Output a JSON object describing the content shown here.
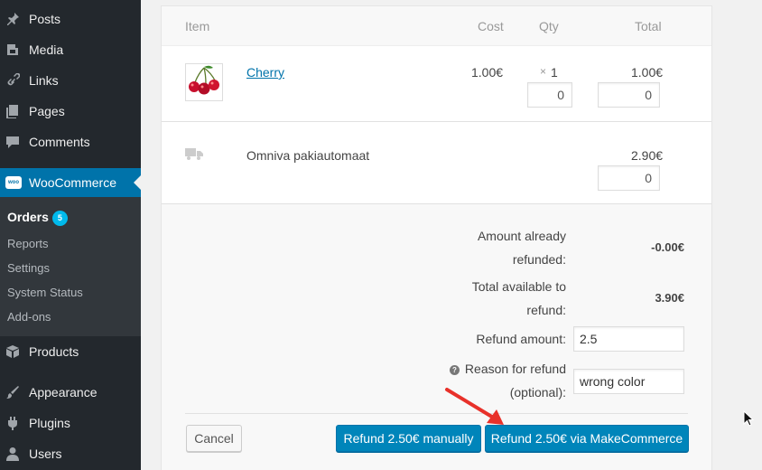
{
  "sidebar": {
    "items": [
      {
        "label": "Posts",
        "icon": "pin-icon"
      },
      {
        "label": "Media",
        "icon": "media-icon"
      },
      {
        "label": "Links",
        "icon": "link-icon"
      },
      {
        "label": "Pages",
        "icon": "pages-icon"
      },
      {
        "label": "Comments",
        "icon": "comment-icon"
      },
      {
        "label": "WooCommerce",
        "icon": "woo-icon"
      },
      {
        "label": "Products",
        "icon": "products-icon"
      },
      {
        "label": "Appearance",
        "icon": "brush-icon"
      },
      {
        "label": "Plugins",
        "icon": "plugin-icon"
      },
      {
        "label": "Users",
        "icon": "user-icon"
      }
    ],
    "woo_logo_text": "woo",
    "submenu": [
      {
        "label": "Orders",
        "count": "5"
      },
      {
        "label": "Reports"
      },
      {
        "label": "Settings"
      },
      {
        "label": "System Status"
      },
      {
        "label": "Add-ons"
      }
    ]
  },
  "table": {
    "headers": {
      "item": "Item",
      "cost": "Cost",
      "qty": "Qty",
      "total": "Total"
    },
    "line_item": {
      "name": "Cherry",
      "cost": "1.00€",
      "qty_prefix": "×",
      "qty": "1",
      "total": "1.00€",
      "refund_qty": "0",
      "refund_total": "0"
    },
    "shipping": {
      "name": "Omniva pakiautomaat",
      "total": "2.90€",
      "refund_total": "0"
    }
  },
  "totals": {
    "already_refunded_label": "Amount already refunded:",
    "already_refunded_value": "-0.00€",
    "available_label": "Total available to refund:",
    "available_value": "3.90€",
    "refund_amount_label": "Refund amount:",
    "refund_amount_value": "2.5",
    "reason_label": "Reason for refund (optional):",
    "reason_value": "wrong color",
    "help_glyph": "?"
  },
  "actions": {
    "cancel": "Cancel",
    "refund_manual": "Refund 2.50€ manually",
    "refund_gateway": "Refund 2.50€ via MakeCommerce"
  },
  "colors": {
    "sidebar_bg": "#23282d",
    "active": "#0073aa",
    "button_primary": "#0085ba",
    "badge": "#00b9eb",
    "arrow": "#e8312a"
  }
}
